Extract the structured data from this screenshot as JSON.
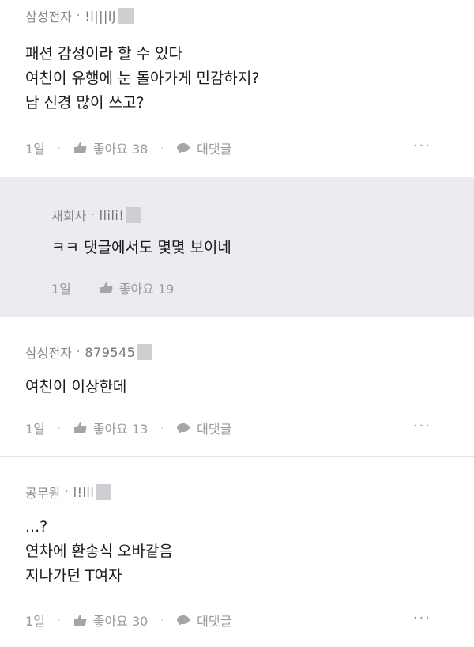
{
  "comments": [
    {
      "company": "삼성전자",
      "user": "!i|||ij",
      "lines": [
        "패션 감성이라 할 수 있다",
        "여친이 유행에 눈 돌아가게 민감하지?",
        "남 신경 많이 쓰고?"
      ],
      "time": "1일",
      "like": "좋아요 38",
      "reply": "대댓글",
      "more": "···"
    },
    {
      "company": "새회사",
      "user": "llili!",
      "lines": [
        "ㅋㅋ 댓글에서도 몇몇 보이네"
      ],
      "time": "1일",
      "like": "좋아요 19"
    },
    {
      "company": "삼성전자",
      "user": "879545",
      "lines": [
        "여친이 이상한데"
      ],
      "time": "1일",
      "like": "좋아요 13",
      "reply": "대댓글",
      "more": "···"
    },
    {
      "company": "공무원",
      "user": "l!lll",
      "lines": [
        "...?",
        "연차에 환송식 오바같음",
        "지나가던 T여자"
      ],
      "time": "1일",
      "like": "좋아요 30",
      "reply": "대댓글",
      "more": "···"
    }
  ]
}
